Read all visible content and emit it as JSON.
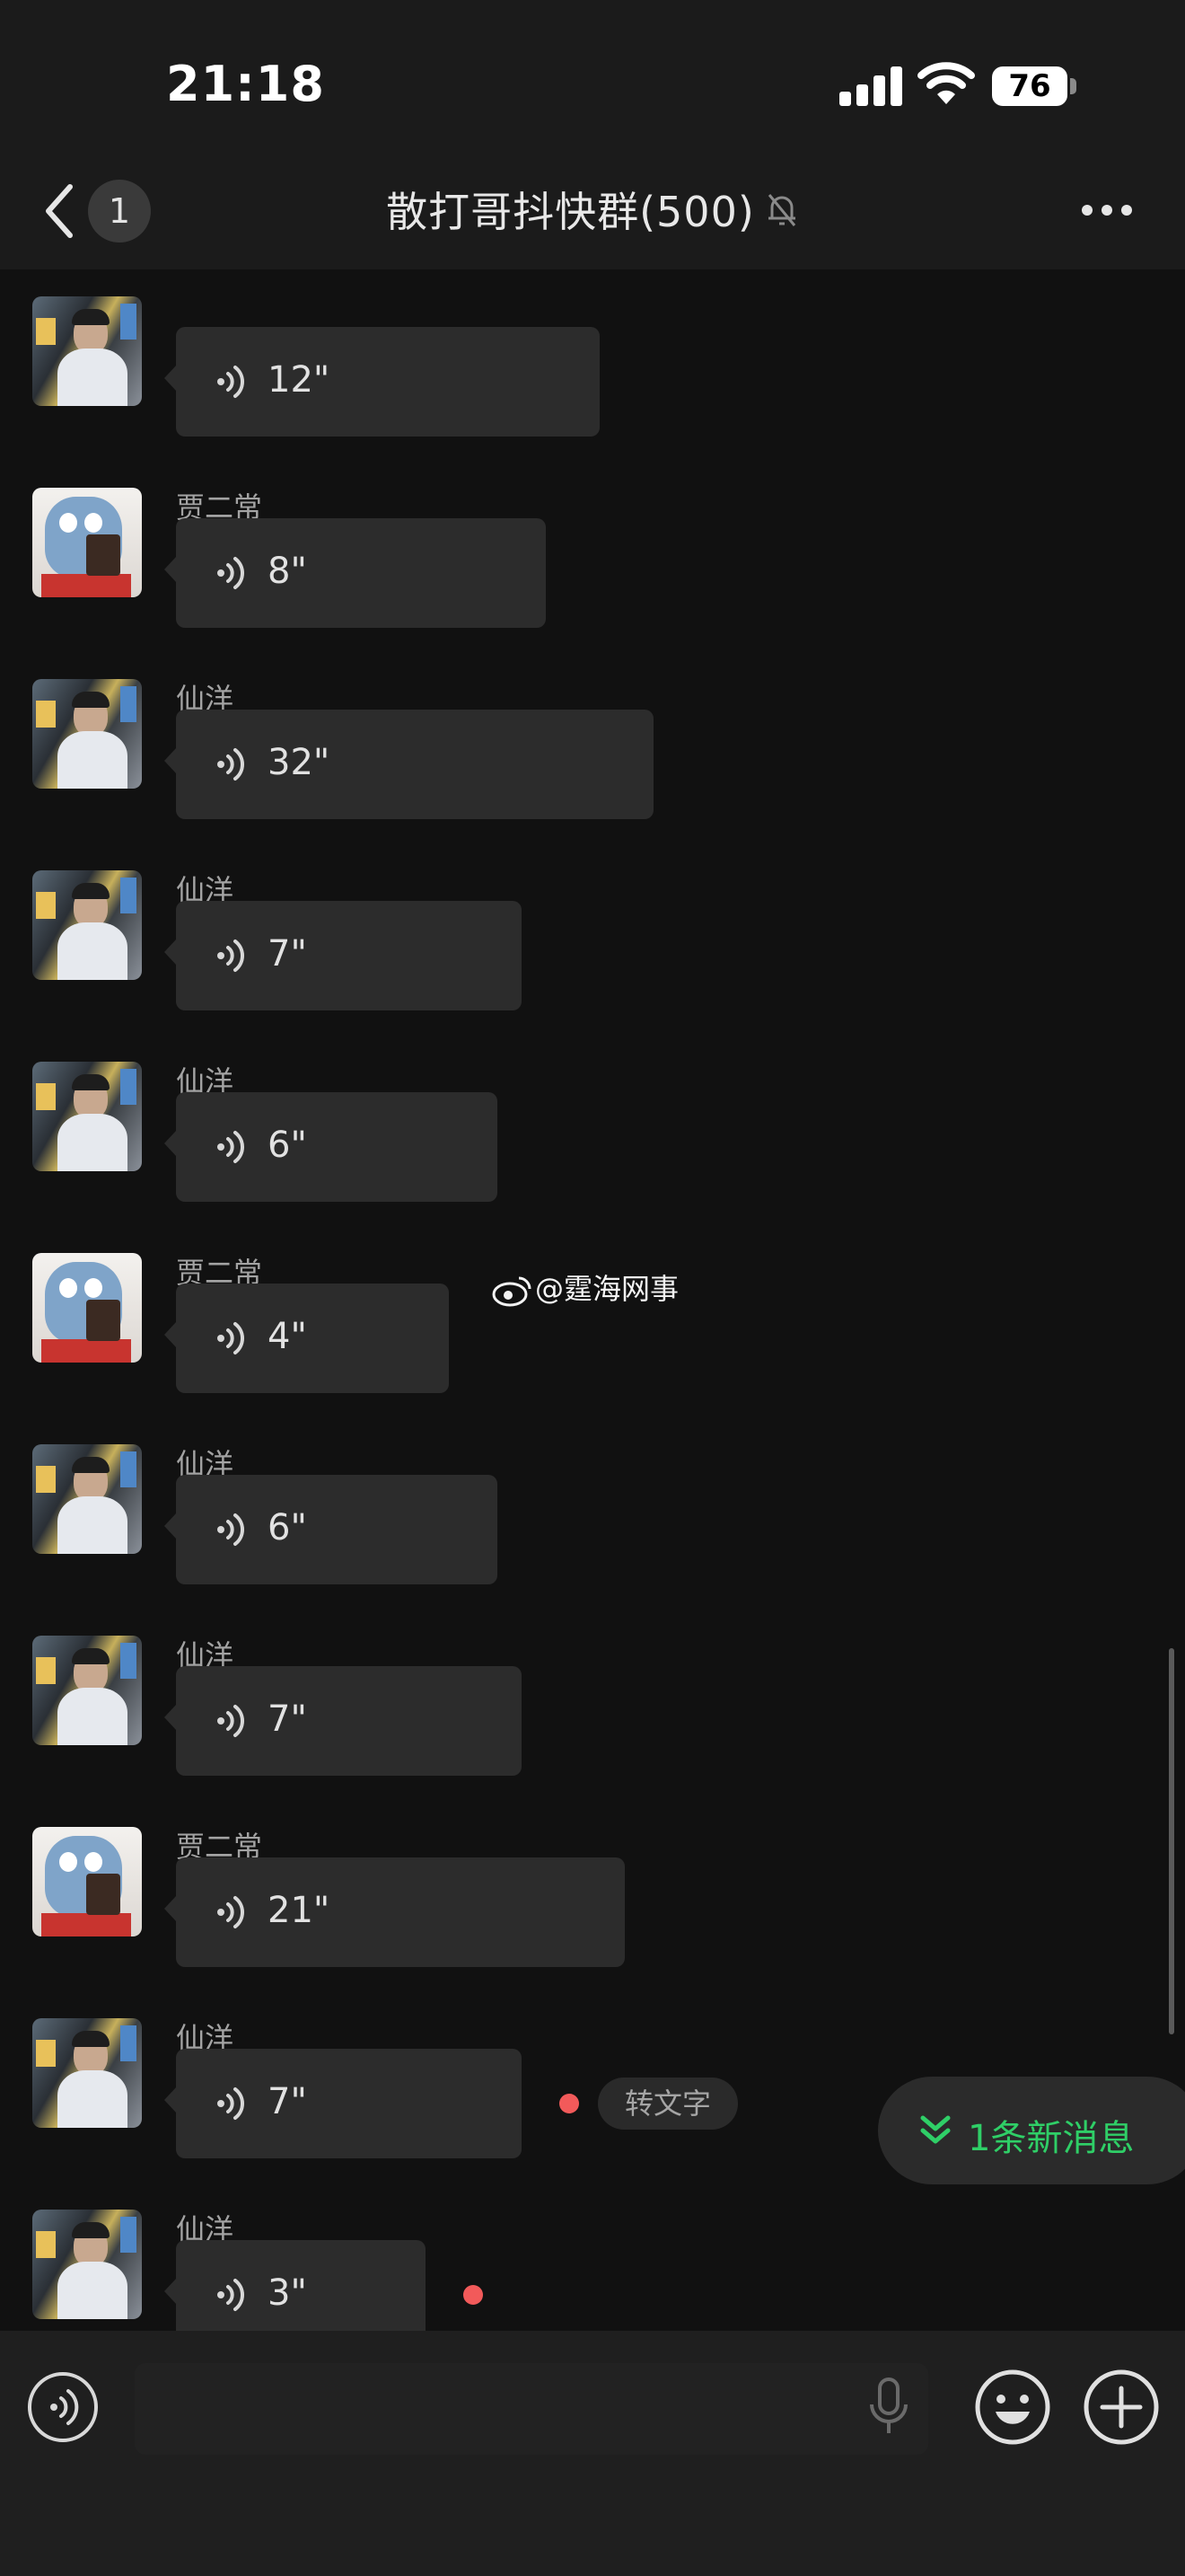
{
  "status": {
    "time": "21:18",
    "battery": "76"
  },
  "header": {
    "back_count": "1",
    "title": "散打哥抖快群(500)",
    "mute_icon": "bell-off-icon",
    "more_icon": "more-dots-icon"
  },
  "messages": [
    {
      "sender": "",
      "duration": "12\"",
      "avatar": "man"
    },
    {
      "sender": "贾二常",
      "duration": "8\"",
      "avatar": "mascot"
    },
    {
      "sender": "仙洋",
      "duration": "32\"",
      "avatar": "man"
    },
    {
      "sender": "仙洋",
      "duration": "7\"",
      "avatar": "man"
    },
    {
      "sender": "仙洋",
      "duration": "6\"",
      "avatar": "man"
    },
    {
      "sender": "贾二常",
      "duration": "4\"",
      "avatar": "mascot"
    },
    {
      "sender": "仙洋",
      "duration": "6\"",
      "avatar": "man"
    },
    {
      "sender": "仙洋",
      "duration": "7\"",
      "avatar": "man"
    },
    {
      "sender": "贾二常",
      "duration": "21\"",
      "avatar": "mascot"
    },
    {
      "sender": "仙洋",
      "duration": "7\"",
      "avatar": "man",
      "unread": true,
      "action": "转文字"
    },
    {
      "sender": "仙洋",
      "duration": "3\"",
      "avatar": "man",
      "unread": true
    }
  ],
  "watermark": "@霆海网事",
  "new_message_pill": "1条新消息",
  "colors": {
    "background": "#111111",
    "bubble": "#2c2c2c",
    "accent_green": "#2fcf67",
    "unread_dot": "#f25a5a"
  },
  "input_bar": {
    "voice_icon": "voice-mode-icon",
    "mic_icon": "microphone-icon",
    "emoji_icon": "emoji-icon",
    "plus_icon": "plus-icon"
  }
}
